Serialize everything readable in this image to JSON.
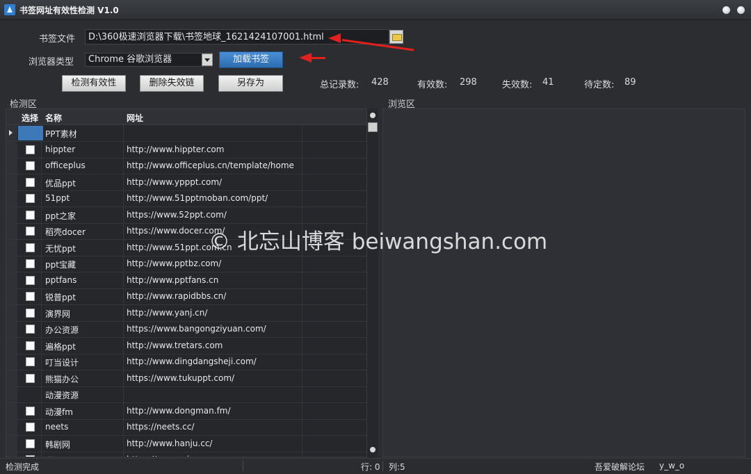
{
  "window": {
    "title": "书签网址有效性检测 V1.0"
  },
  "form": {
    "file_label": "书签文件",
    "file_value": "D:\\360极速浏览器下载\\书签地球_1621424107001.html",
    "browser_label": "浏览器类型",
    "browser_value": "Chrome 谷歌浏览器",
    "load_button": "加载书签"
  },
  "actions": {
    "check_button": "检测有效性",
    "delete_button": "删除失效链",
    "save_button": "另存为"
  },
  "stats": {
    "total_label": "总记录数:",
    "total_value": "428",
    "valid_label": "有效数:",
    "valid_value": "298",
    "invalid_label": "失效数:",
    "invalid_value": "41",
    "pending_label": "待定数:",
    "pending_value": "89"
  },
  "panels": {
    "check_area": "检测区",
    "browse_area": "浏览区"
  },
  "table": {
    "columns": {
      "select": "选择",
      "name": "名称",
      "url": "网址"
    },
    "rows": [
      {
        "type": "group",
        "name": "PPT素材",
        "url": ""
      },
      {
        "type": "item",
        "name": "hippter",
        "url": "http://www.hippter.com"
      },
      {
        "type": "item",
        "name": "officeplus",
        "url": "http://www.officeplus.cn/template/home"
      },
      {
        "type": "item",
        "name": "优品ppt",
        "url": "http://www.ypppt.com/"
      },
      {
        "type": "item",
        "name": "51ppt",
        "url": "http://www.51pptmoban.com/ppt/"
      },
      {
        "type": "item",
        "name": "ppt之家",
        "url": "https://www.52ppt.com/"
      },
      {
        "type": "item",
        "name": "稻壳docer",
        "url": "https://www.docer.com/"
      },
      {
        "type": "item",
        "name": "无忧ppt",
        "url": "http://www.51ppt.com.cn"
      },
      {
        "type": "item",
        "name": "ppt宝藏",
        "url": "http://www.pptbz.com/"
      },
      {
        "type": "item",
        "name": "pptfans",
        "url": "http://www.pptfans.cn"
      },
      {
        "type": "item",
        "name": "锐普ppt",
        "url": "http://www.rapidbbs.cn/"
      },
      {
        "type": "item",
        "name": "演界网",
        "url": "http://www.yanj.cn/"
      },
      {
        "type": "item",
        "name": "办公资源",
        "url": "https://www.bangongziyuan.com/"
      },
      {
        "type": "item",
        "name": "遍格ppt",
        "url": "http://www.tretars.com"
      },
      {
        "type": "item",
        "name": "叮当设计",
        "url": "http://www.dingdangsheji.com/"
      },
      {
        "type": "item",
        "name": "熊猫办公",
        "url": "https://www.tukuppt.com/"
      },
      {
        "type": "group",
        "name": "动漫资源",
        "url": ""
      },
      {
        "type": "item",
        "name": "动漫fm",
        "url": "http://www.dongman.fm/"
      },
      {
        "type": "item",
        "name": "neets",
        "url": "https://neets.cc/"
      },
      {
        "type": "item",
        "name": "韩剧网",
        "url": "http://www.hanju.cc/"
      },
      {
        "type": "item",
        "name": "猫耳fm",
        "url": "https://www.missevan.com"
      }
    ]
  },
  "status": {
    "text": "检测完成",
    "row": "行: 0",
    "col": "列:5",
    "forum": "吾爱破解论坛",
    "user": "y_w_o"
  },
  "watermark": "© 北忘山博客 beiwangshan.com",
  "colors": {
    "accent": "#2c6db0",
    "annotation": "#e3201b",
    "background": "#2b2d31"
  }
}
